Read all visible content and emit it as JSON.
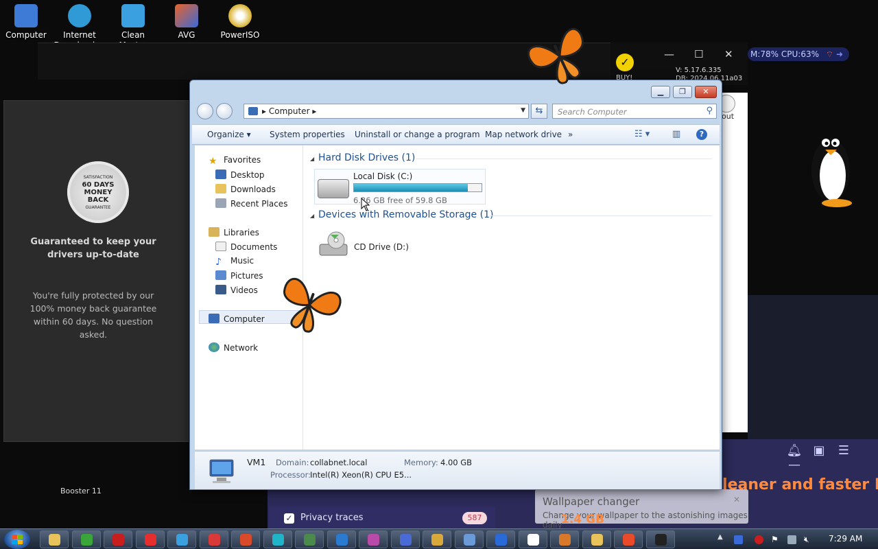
{
  "desktop_icons": [
    {
      "label": "Computer",
      "icon": "computer-icon",
      "color": "#3d7bd6"
    },
    {
      "label": "Internet Download ...",
      "icon": "idm-globe-icon",
      "color": "#2f9ad6"
    },
    {
      "label": "Clean Master",
      "icon": "broom-icon",
      "color": "#3aa0e0"
    },
    {
      "label": "AVG",
      "icon": "avg-icon",
      "color": "#e8632a"
    },
    {
      "label": "PowerISO",
      "icon": "disc-icon",
      "color": "#d8b02a"
    }
  ],
  "background": {
    "badge_text": "60 DAYS MONEY BACK",
    "badge_arc_top": "SATISFACTION",
    "badge_arc_bottom": "GUARANTEE",
    "headline": "Guaranteed to keep your drivers up-to-date",
    "paragraph": "You're fully protected by our 100% money back guarantee within 60 days. No question asked.",
    "buy_label": "BUY!",
    "version": "V: 5.17.6.335",
    "version_line2": "DB: 2024.06.11a03",
    "sys_stats": "M:78%  CPU:63%",
    "out_label": "out",
    "privacy_label": "Privacy traces",
    "privacy_count": "587",
    "promo_text": "cleaner and faster PC.",
    "booster_label": "Booster 11",
    "size_label": "1.4 GB"
  },
  "toast": {
    "title": "Wallpaper changer",
    "body": "Change your wallpaper to the astonishing images daily"
  },
  "explorer": {
    "address_crumb": "Computer",
    "search_placeholder": "Search Computer",
    "commands": {
      "organize": "Organize",
      "system_properties": "System properties",
      "uninstall": "Uninstall or change a program",
      "map_drive": "Map network drive",
      "more": "»"
    },
    "nav": {
      "favorites": "Favorites",
      "desktop": "Desktop",
      "downloads": "Downloads",
      "recent_places": "Recent Places",
      "libraries": "Libraries",
      "documents": "Documents",
      "music": "Music",
      "pictures": "Pictures",
      "videos": "Videos",
      "computer": "Computer",
      "network": "Network"
    },
    "groups": {
      "hdd": "Hard Disk Drives (1)",
      "removable": "Devices with Removable Storage (1)"
    },
    "local_disk": {
      "name": "Local Disk (C:)",
      "free_text": "6.26 GB free of 59.8 GB",
      "used_fraction": 0.895
    },
    "cd_drive": {
      "name": "CD Drive (D:)"
    },
    "details": {
      "name": "VM1",
      "domain_label": "Domain:",
      "domain_value": "collabnet.local",
      "memory_label": "Memory:",
      "memory_value": "4.00 GB",
      "processor_label": "Processor:",
      "processor_value": "Intel(R) Xeon(R) CPU E5..."
    }
  },
  "taskbar": {
    "clock": "7:29 AM",
    "apps": [
      {
        "icon": "explorer-folder-icon",
        "color": "#e8c25a"
      },
      {
        "icon": "utorrent-icon",
        "color": "#3aa63a"
      },
      {
        "icon": "opera-icon",
        "color": "#c81e1e"
      },
      {
        "icon": "yandex-icon",
        "color": "#e62e2e"
      },
      {
        "icon": "clean-master-icon",
        "color": "#3aa0e0"
      },
      {
        "icon": "video-app-icon",
        "color": "#d83a3a"
      },
      {
        "icon": "tools-icon",
        "color": "#d84a2a"
      },
      {
        "icon": "xmind-icon",
        "color": "#1fb4c8"
      },
      {
        "icon": "terminal-icon",
        "color": "#4a8a4a"
      },
      {
        "icon": "globe-icon",
        "color": "#2a7ad0"
      },
      {
        "icon": "app-grid-icon",
        "color": "#b84aa8"
      },
      {
        "icon": "remote-desktop-icon",
        "color": "#4a6ad8"
      },
      {
        "icon": "pen-icon",
        "color": "#d8a83a"
      },
      {
        "icon": "monitor-icon",
        "color": "#6a9ad8"
      },
      {
        "icon": "ccleaner-icon",
        "color": "#2a6ad8"
      },
      {
        "icon": "windows-icon",
        "color": "#ffffff"
      },
      {
        "icon": "photos-icon",
        "color": "#d8782a"
      },
      {
        "icon": "folder-icon",
        "color": "#e8c25a"
      },
      {
        "icon": "media-player-icon",
        "color": "#e84a2a"
      },
      {
        "icon": "penguin-app-icon",
        "color": "#222222"
      }
    ]
  },
  "colors": {
    "explorer_frame": "#c3d7ec",
    "group_header": "#1d4f91",
    "disk_fill": "#1a8cb4",
    "promo": "#ff8a3d",
    "purple_panel": "#2b2a58"
  }
}
